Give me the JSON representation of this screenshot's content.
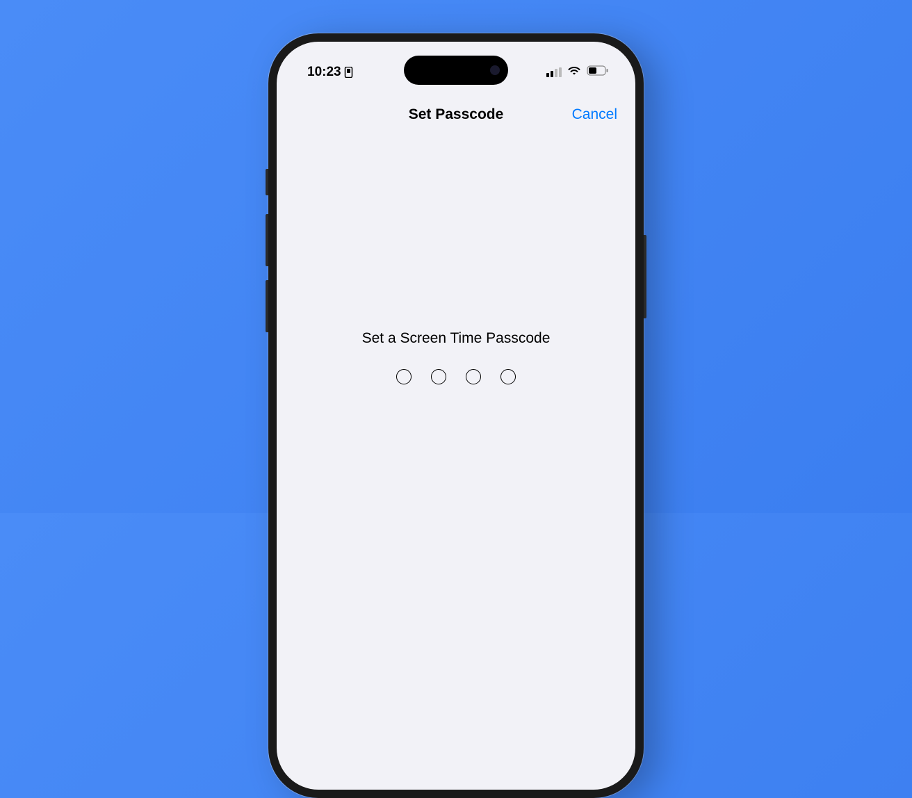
{
  "status_bar": {
    "time": "10:23",
    "signal_bars_active": 2,
    "signal_bars_total": 4
  },
  "nav": {
    "title": "Set Passcode",
    "cancel_label": "Cancel"
  },
  "content": {
    "prompt": "Set a Screen Time Passcode",
    "passcode_length": 4,
    "digits_entered": 0
  },
  "colors": {
    "background": "#3b7ef0",
    "link": "#007aff",
    "screen_bg": "#f2f2f7"
  }
}
